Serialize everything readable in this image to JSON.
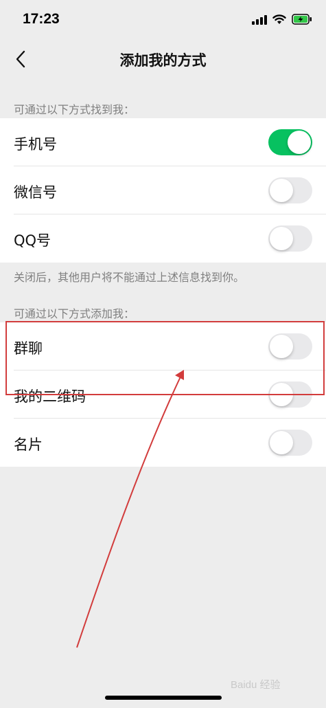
{
  "status_bar": {
    "time": "17:23"
  },
  "nav": {
    "title": "添加我的方式"
  },
  "find_me": {
    "caption": "可通过以下方式找到我：",
    "items": [
      {
        "label": "手机号",
        "enabled": true
      },
      {
        "label": "微信号",
        "enabled": false
      },
      {
        "label": "QQ号",
        "enabled": false
      }
    ],
    "footer": "关闭后，其他用户将不能通过上述信息找到你。"
  },
  "add_me": {
    "caption": "可通过以下方式添加我：",
    "items": [
      {
        "label": "群聊",
        "enabled": false
      },
      {
        "label": "我的二维码",
        "enabled": false
      },
      {
        "label": "名片",
        "enabled": false
      }
    ]
  },
  "watermark": "Baidu 经验",
  "colors": {
    "toggle_on": "#07c160",
    "annotation": "#d23c3c",
    "background": "#ededed"
  }
}
